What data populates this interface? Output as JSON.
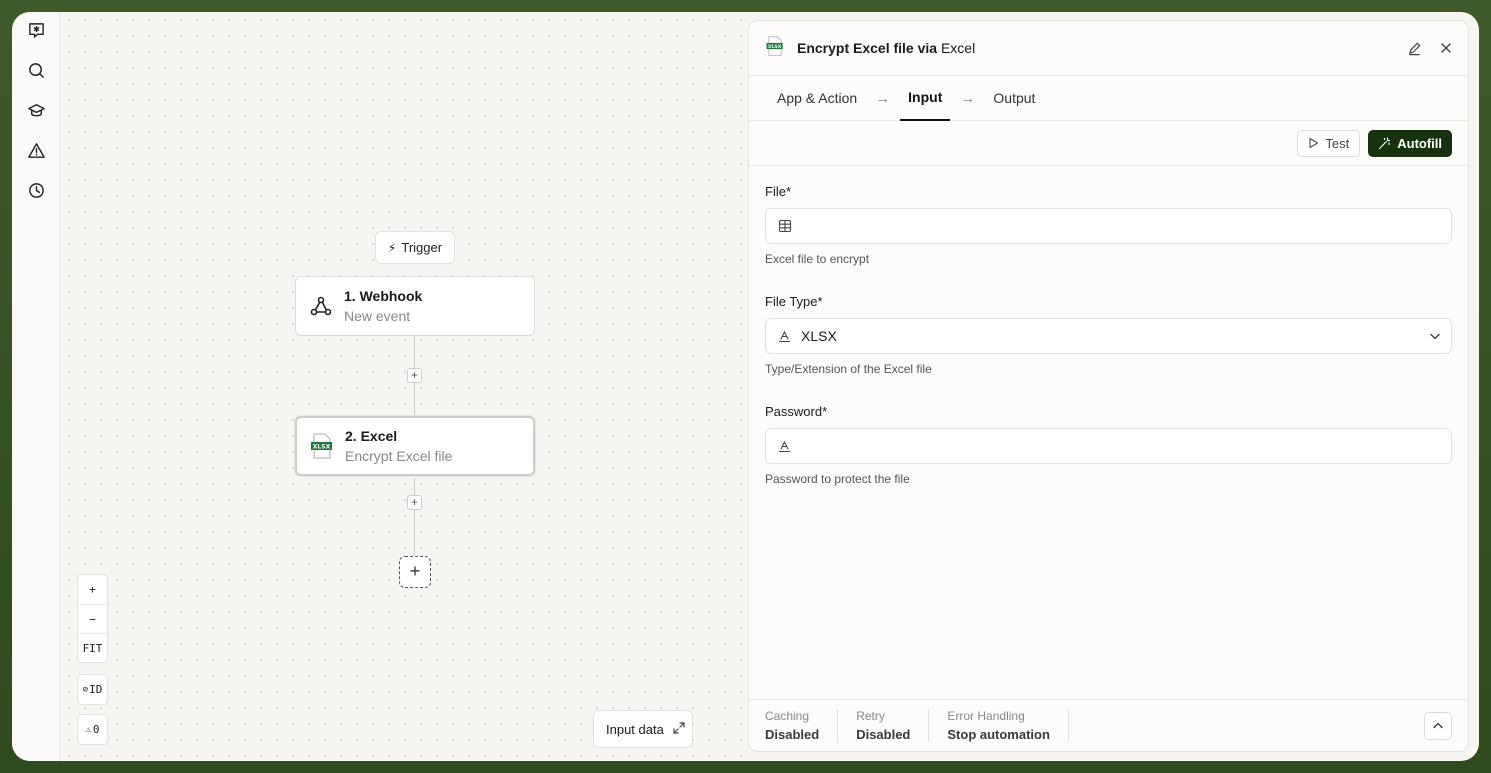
{
  "canvas": {
    "trigger_label": "Trigger",
    "nodes": [
      {
        "title": "1. Webhook",
        "subtitle": "New event"
      },
      {
        "title": "2. Excel",
        "subtitle": "Encrypt Excel file",
        "icon_text": "XLSX"
      }
    ],
    "zoom": {
      "in": "+",
      "out": "−",
      "fit": "FIT",
      "id_toggle": "ID",
      "warnings": "0"
    },
    "input_data_label": "Input data"
  },
  "panel": {
    "title": "Encrypt Excel file via",
    "app_name": "Excel",
    "icon_text": "XLSX",
    "tabs": [
      "App & Action",
      "Input",
      "Output"
    ],
    "active_tab": "Input",
    "test_label": "Test",
    "autofill_label": "Autofill",
    "fields": [
      {
        "label": "File*",
        "value": "",
        "help": "Excel file to encrypt"
      },
      {
        "label": "File Type*",
        "value": "XLSX",
        "help": "Type/Extension of the Excel file"
      },
      {
        "label": "Password*",
        "value": "",
        "help": "Password to protect the file"
      }
    ],
    "footer": [
      {
        "label": "Caching",
        "value": "Disabled"
      },
      {
        "label": "Retry",
        "value": "Disabled"
      },
      {
        "label": "Error Handling",
        "value": "Stop automation"
      }
    ]
  },
  "colors": {
    "accent": "#16320f",
    "frame": "#3f5a2a",
    "excel_green": "#1e7a3c"
  }
}
